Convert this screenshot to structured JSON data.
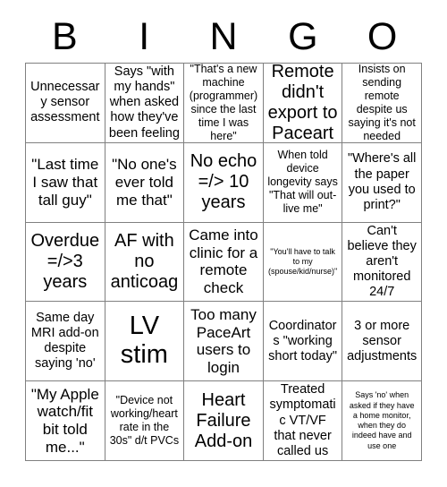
{
  "card": {
    "title": "BINGO",
    "header_letters": [
      "B",
      "I",
      "N",
      "G",
      "O"
    ],
    "colors": {
      "background": "#ffffff",
      "text": "#000000",
      "grid_line": "#808080"
    },
    "grid": {
      "columns": 5,
      "rows": 5
    },
    "cells": [
      {
        "id": "b1",
        "column": "B",
        "row": 1,
        "text": "Unnecessary sensor assessment",
        "size": "sz-md"
      },
      {
        "id": "i1",
        "column": "I",
        "row": 1,
        "text": "Says \"with my hands\" when asked how they've been feeling",
        "size": "sz-md"
      },
      {
        "id": "n1",
        "column": "N",
        "row": 1,
        "text": "\"That's a new machine (programmer) since the last time I was here\"",
        "size": "sz-sm"
      },
      {
        "id": "g1",
        "column": "G",
        "row": 1,
        "text": "Remote didn't export to Paceart",
        "size": "sz-xl"
      },
      {
        "id": "o1",
        "column": "O",
        "row": 1,
        "text": "Insists on sending remote despite us saying it's not needed",
        "size": "sz-sm"
      },
      {
        "id": "b2",
        "column": "B",
        "row": 2,
        "text": "\"Last time I saw that tall guy\"",
        "size": "sz-lg"
      },
      {
        "id": "i2",
        "column": "I",
        "row": 2,
        "text": "\"No one's ever told me that\"",
        "size": "sz-lg"
      },
      {
        "id": "n2",
        "column": "N",
        "row": 2,
        "text": "No echo =/> 10 years",
        "size": "sz-xl"
      },
      {
        "id": "g2",
        "column": "G",
        "row": 2,
        "text": "When told device longevity says \"That will out-live me\"",
        "size": "sz-sm"
      },
      {
        "id": "o2",
        "column": "O",
        "row": 2,
        "text": "\"Where's all the paper you used to print?\"",
        "size": "sz-md"
      },
      {
        "id": "b3",
        "column": "B",
        "row": 3,
        "text": "Overdue =/>3 years",
        "size": "sz-xl"
      },
      {
        "id": "i3",
        "column": "I",
        "row": 3,
        "text": "AF with no anticoag",
        "size": "sz-xl"
      },
      {
        "id": "n3",
        "column": "N",
        "row": 3,
        "text": "Came into clinic for a remote check",
        "size": "sz-lg"
      },
      {
        "id": "g3",
        "column": "G",
        "row": 3,
        "text": "\"You'll have to talk to my (spouse/kid/nurse)\"",
        "size": "sz-xxs"
      },
      {
        "id": "o3",
        "column": "O",
        "row": 3,
        "text": "Can't believe they aren't monitored 24/7",
        "size": "sz-md"
      },
      {
        "id": "b4",
        "column": "B",
        "row": 4,
        "text": "Same day MRI add-on despite saying 'no'",
        "size": "sz-md"
      },
      {
        "id": "i4",
        "column": "I",
        "row": 4,
        "text": "LV stim",
        "size": "sz-xxl"
      },
      {
        "id": "n4",
        "column": "N",
        "row": 4,
        "text": "Too many PaceArt users to login",
        "size": "sz-lg"
      },
      {
        "id": "g4",
        "column": "G",
        "row": 4,
        "text": "Coordinators \"working short today\"",
        "size": "sz-md"
      },
      {
        "id": "o4",
        "column": "O",
        "row": 4,
        "text": "3 or more sensor adjustments",
        "size": "sz-md"
      },
      {
        "id": "b5",
        "column": "B",
        "row": 5,
        "text": "\"My Apple watch/fit bit told me...\"",
        "size": "sz-lg"
      },
      {
        "id": "i5",
        "column": "I",
        "row": 5,
        "text": "\"Device not working/heart rate in the 30s\" d/t PVCs",
        "size": "sz-sm"
      },
      {
        "id": "n5",
        "column": "N",
        "row": 5,
        "text": "Heart Failure Add-on",
        "size": "sz-xl"
      },
      {
        "id": "g5",
        "column": "G",
        "row": 5,
        "text": "Treated symptomatic VT/VF that never called us",
        "size": "sz-md"
      },
      {
        "id": "o5",
        "column": "O",
        "row": 5,
        "text": "Says 'no' when asked if they have a home monitor, when they do indeed have and use one",
        "size": "sz-xxs"
      }
    ]
  }
}
